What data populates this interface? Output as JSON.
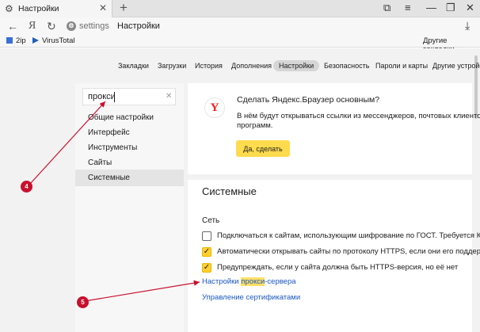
{
  "tab": {
    "title": "Настройки"
  },
  "address": {
    "host": "settings",
    "page": "Настройки"
  },
  "bookmarks": {
    "items": [
      {
        "label": "2ip"
      },
      {
        "label": "VirusTotal"
      }
    ],
    "other": "Другие закладки"
  },
  "topnav": {
    "items": [
      "Закладки",
      "Загрузки",
      "История",
      "Дополнения",
      "Настройки",
      "Безопасность",
      "Пароли и карты",
      "Другие устройс"
    ]
  },
  "search": {
    "value": "прокси"
  },
  "leftnav": {
    "items": [
      "Общие настройки",
      "Интерфейс",
      "Инструменты",
      "Сайты",
      "Системные"
    ]
  },
  "promo": {
    "title": "Сделать Яндекс.Браузер основным?",
    "line1": "В нём будут открываться ссылки из мессенджеров, почтовых клиентов и",
    "line2": "программ.",
    "button": "Да, сделать"
  },
  "system": {
    "title": "Системные",
    "network_title": "Сеть",
    "options": [
      {
        "label": "Подключаться к сайтам, использующим шифрование по ГОСТ. Требуется Крипт",
        "checked": false
      },
      {
        "label": "Автоматически открывать сайты по протоколу HTTPS, если они его поддержив",
        "checked": true
      },
      {
        "label": "Предупреждать, если у сайта должна быть HTTPS-версия, но её нет",
        "checked": true
      }
    ],
    "proxy_link": {
      "before": "Настройки ",
      "highlight": "прокси",
      "after": "-сервера"
    },
    "certs_link": "Управление сертификатами"
  },
  "annotations": [
    "4",
    "5"
  ],
  "colors": {
    "annotation": "#c8102e",
    "accent_yellow": "#ffdb4d",
    "link": "#1a56c2"
  }
}
